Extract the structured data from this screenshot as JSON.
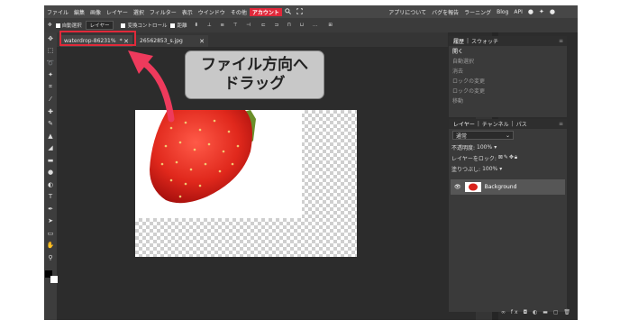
{
  "menubar": {
    "items": [
      "ファイル",
      "編集",
      "画像",
      "レイヤー",
      "選択",
      "フィルター",
      "表示",
      "ウインドウ",
      "その他"
    ],
    "active": "アカウント",
    "right_items": [
      "アプリについて",
      "バグを報告",
      "ラーニング",
      "Blog",
      "API"
    ]
  },
  "options": {
    "auto_select": "自動選択",
    "layer_select": "レイヤー",
    "transform": "変換コントロール",
    "distance": "距離"
  },
  "tabs": [
    {
      "label": "waterdrop-86231%",
      "mod": "*"
    },
    {
      "label": "26562853_s.jpg"
    }
  ],
  "callout": {
    "line1": "ファイル方向へ",
    "line2": "ドラッグ"
  },
  "history_panel": {
    "tabs": [
      "履歴",
      "スウォッチ"
    ],
    "items": [
      "開く",
      "自動選択",
      "消去",
      "ロックの変更",
      "ロックの変更",
      "移動"
    ]
  },
  "layers_panel": {
    "tabs": [
      "レイヤー",
      "チャンネル",
      "パス"
    ],
    "blend_mode": "通常",
    "opacity_label": "不透明度:",
    "opacity_value": "100%",
    "lock_label": "レイヤーをロック:",
    "fill_label": "塗りつぶし:",
    "fill_value": "100%",
    "layer_name": "Background"
  },
  "colors": {
    "accent": "#e0283a",
    "app_bg": "#2c2c2c",
    "panel": "#3a3a3a"
  }
}
